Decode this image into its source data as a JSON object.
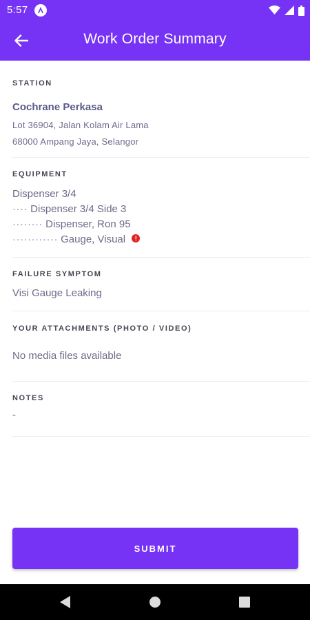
{
  "status_bar": {
    "time": "5:57"
  },
  "app_bar": {
    "title": "Work Order Summary"
  },
  "station": {
    "label": "STATION",
    "name": "Cochrane Perkasa",
    "address_line1": "Lot 36904, Jalan Kolam Air Lama",
    "address_line2": "68000 Ampang Jaya, Selangor"
  },
  "equipment": {
    "label": "EQUIPMENT",
    "items": [
      {
        "prefix": "",
        "text": "Dispenser 3/4"
      },
      {
        "prefix": "····",
        "text": "Dispenser 3/4 Side 3"
      },
      {
        "prefix": "········",
        "text": "Dispenser, Ron 95"
      },
      {
        "prefix": "············",
        "text": "Gauge, Visual",
        "warning": "!"
      }
    ]
  },
  "failure_symptom": {
    "label": "FAILURE SYMPTOM",
    "value": "Visi Gauge Leaking"
  },
  "attachments": {
    "label": "YOUR ATTACHMENTS (PHOTO / VIDEO)",
    "value": "No media files available"
  },
  "notes": {
    "label": "NOTES",
    "value": "-"
  },
  "submit": {
    "label": "SUBMIT"
  },
  "colors": {
    "primary": "#7733f5",
    "warning": "#e02424"
  },
  "icons": [
    "arrow-back-icon",
    "wifi-icon",
    "signal-icon",
    "battery-icon",
    "nav-back-icon",
    "nav-home-icon",
    "nav-recents-icon"
  ]
}
